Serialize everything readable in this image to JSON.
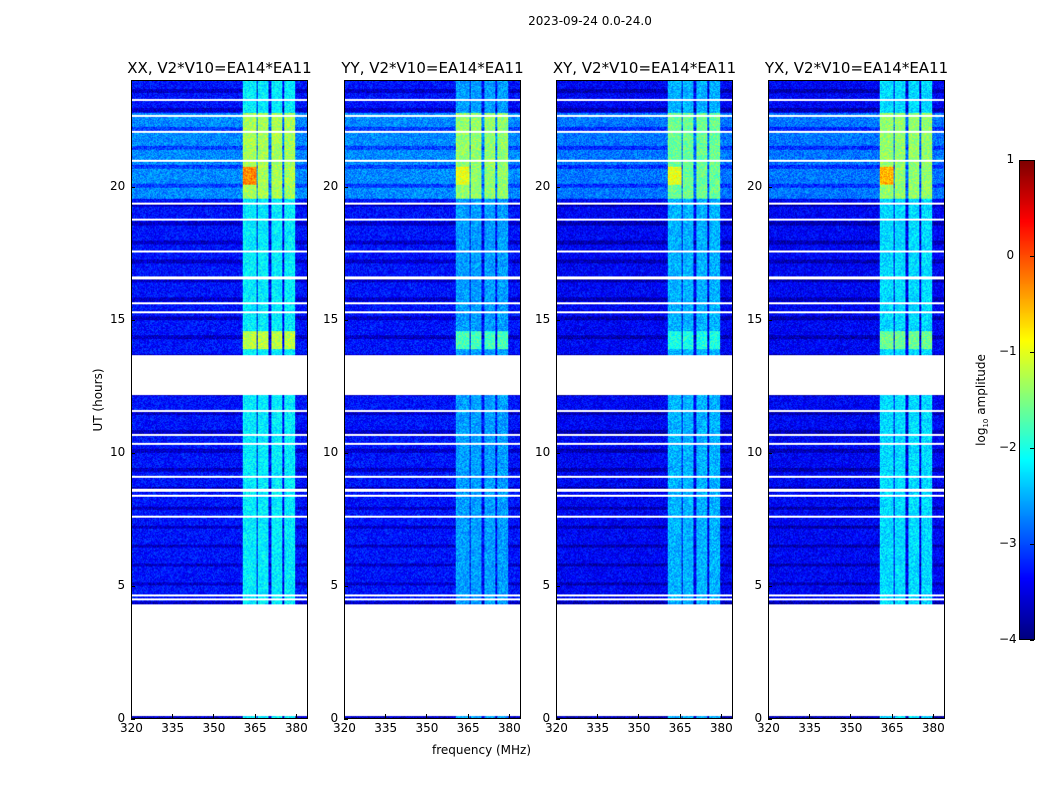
{
  "suptitle": "2023-09-24 0.0-24.0",
  "chart_data": {
    "type": "heatmap",
    "xlabel": "frequency (MHz)",
    "ylabel": "UT (hours)",
    "xlim": [
      320,
      384.4
    ],
    "ylim": [
      0,
      24
    ],
    "xticks": [
      "320",
      "335",
      "350",
      "365",
      "380"
    ],
    "xtick_values": [
      320,
      335,
      350,
      365,
      380
    ],
    "yticks": [
      "0",
      "5",
      "10",
      "15",
      "20"
    ],
    "ytick_values": [
      0,
      5,
      10,
      15,
      20
    ],
    "data_time_ranges": [
      [
        0,
        0.1
      ],
      [
        4.3,
        12.2
      ],
      [
        13.7,
        24
      ]
    ],
    "flagged_times": [
      4.5,
      4.65,
      7.6,
      8.4,
      8.6,
      9.1,
      10.35,
      10.7,
      11.6,
      15.3,
      15.65,
      16.6,
      17.6,
      18.8,
      19.4,
      21.0,
      22.1,
      22.7,
      23.3
    ],
    "bright_channels_mhz": [
      [
        360.7,
        365.5
      ],
      [
        366,
        370
      ],
      [
        371,
        375
      ],
      [
        376,
        380
      ]
    ],
    "panels": [
      {
        "title": "XX, V2*V10=EA14*EA11",
        "background_log_amp": -3.3,
        "rfi_evening_log_amp": -1.3,
        "rfi_14h_log_amp": -1.2,
        "rfi_other_log_amp": -2.2,
        "peak_log_amp": -0.3
      },
      {
        "title": "YY, V2*V10=EA14*EA11",
        "background_log_amp": -3.3,
        "rfi_evening_log_amp": -1.4,
        "rfi_14h_log_amp": -1.8,
        "rfi_other_log_amp": -2.6,
        "peak_log_amp": -1.0
      },
      {
        "title": "XY, V2*V10=EA14*EA11",
        "background_log_amp": -3.4,
        "rfi_evening_log_amp": -1.6,
        "rfi_14h_log_amp": -2.0,
        "rfi_other_log_amp": -2.5,
        "peak_log_amp": -1.0
      },
      {
        "title": "YX, V2*V10=EA14*EA11",
        "background_log_amp": -3.4,
        "rfi_evening_log_amp": -1.4,
        "rfi_14h_log_amp": -1.6,
        "rfi_other_log_amp": -2.3,
        "peak_log_amp": -0.5
      }
    ],
    "colorbar": {
      "label": "log10 amplitude",
      "label_main": "log",
      "label_sub": "10",
      "label_rest": " amplitude",
      "range": [
        -4,
        1
      ],
      "ticks": [
        "1",
        "0",
        "−1",
        "−2",
        "−3",
        "−4"
      ],
      "tick_values": [
        1,
        0,
        -1,
        -2,
        -3,
        -4
      ],
      "colormap": "jet"
    }
  }
}
